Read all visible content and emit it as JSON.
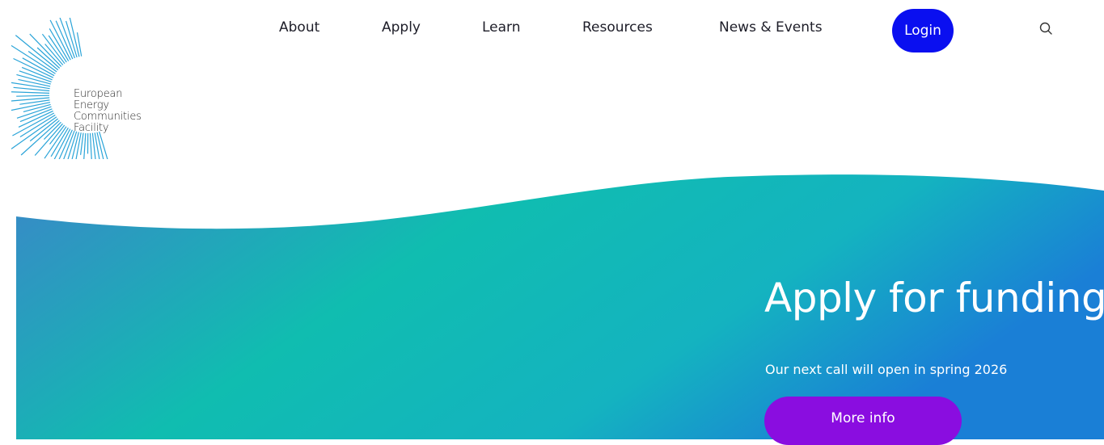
{
  "logo": {
    "icon": "sunburst-logo-icon",
    "lines": [
      "European",
      "Energy",
      "Communities",
      "Facility"
    ]
  },
  "nav": {
    "items": [
      {
        "label": "About"
      },
      {
        "label": "Apply"
      },
      {
        "label": "Learn"
      },
      {
        "label": "Resources"
      },
      {
        "label": "News & Events"
      }
    ],
    "login_label": "Login",
    "search_icon": "search-icon"
  },
  "hero": {
    "title": "Apply for funding",
    "subtitle": "Our next call will open in spring 2026",
    "button_label": "More info"
  },
  "colors": {
    "login_bg": "#0a0ff0",
    "button_bg": "#8a0de0",
    "gradient_left": "#3a87c8",
    "gradient_mid": "#10bdb0",
    "gradient_right": "#1a7fd6",
    "logo_blue": "#2aa4d8"
  }
}
